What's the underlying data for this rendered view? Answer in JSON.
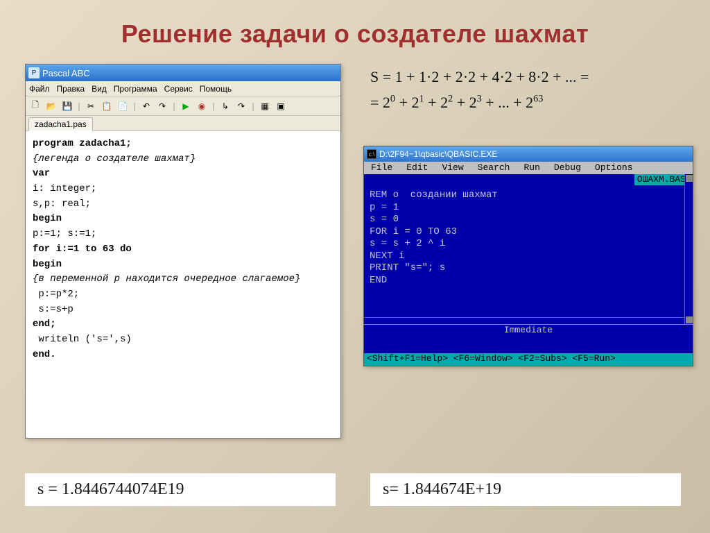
{
  "title": "Решение задачи о создателе шахмат",
  "pascal": {
    "window_title": "Pascal ABC",
    "menu": [
      "Файл",
      "Правка",
      "Вид",
      "Программа",
      "Сервис",
      "Помощь"
    ],
    "tab": "zadacha1.pas",
    "code_lines": [
      {
        "kind": "kw",
        "text": "program zadacha1;"
      },
      {
        "kind": "cm",
        "text": "{легенда о создателе шахмат}"
      },
      {
        "kind": "kw",
        "text": "var"
      },
      {
        "kind": "",
        "text": "i: integer;"
      },
      {
        "kind": "",
        "text": "s,p: real;"
      },
      {
        "kind": "kw",
        "text": "begin"
      },
      {
        "kind": "",
        "text": "p:=1; s:=1;"
      },
      {
        "kind": "kw",
        "text": "for i:=1 to 63 do"
      },
      {
        "kind": "kw",
        "text": "begin"
      },
      {
        "kind": "cm",
        "text": "{в переменной p находится очередное слагаемое}"
      },
      {
        "kind": "",
        "text": " p:=p*2;"
      },
      {
        "kind": "",
        "text": " s:=s+p"
      },
      {
        "kind": "kw",
        "text": "end;"
      },
      {
        "kind": "",
        "text": " writeln ('s=',s)"
      },
      {
        "kind": "kw",
        "text": "end."
      }
    ]
  },
  "formula": {
    "line1": "S = 1 + 1·2 + 2·2 + 4·2 + 8·2 + ... =",
    "line2_html": "= 2<sup>0</sup> + 2<sup>1</sup> + 2<sup>2</sup> + 2<sup>3</sup> + ... + 2<sup>63</sup>"
  },
  "qbasic": {
    "window_title": "D:\\2F94~1\\qbasic\\QBASIC.EXE",
    "menu": [
      "File",
      "Edit",
      "View",
      "Search",
      "Run",
      "Debug",
      "Options"
    ],
    "file_label": "ОШАХМ.BAS",
    "code_lines": [
      "REM о  создании шахмат",
      "p = 1",
      "s = 0",
      "FOR i = 0 TO 63",
      "s = s + 2 ^ i",
      "NEXT i",
      "PRINT \"s=\"; s",
      "END"
    ],
    "immediate": "Immediate",
    "status": " <Shift+F1=Help> <F6=Window> <F2=Subs> <F5=Run>"
  },
  "results": {
    "left": "s = 1.8446744074E19",
    "right": "s= 1.844674E+19"
  },
  "chart_data": {
    "type": "table",
    "description": "Geometric series sum 2^0..2^63",
    "exponent_range": [
      0,
      63
    ],
    "base": 2,
    "expected_sum_approx": 1.8446744073709552e+19,
    "pascal_output": "1.8446744074E19",
    "qbasic_output": "1.844674E+19"
  }
}
